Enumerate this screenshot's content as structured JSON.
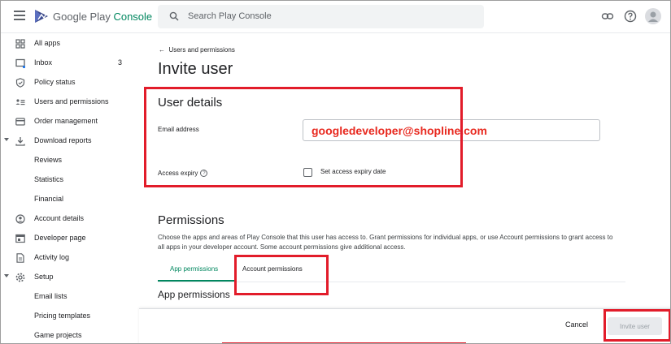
{
  "app": {
    "brand_google": "Google Play",
    "brand_console": "Console",
    "search_placeholder": "Search Play Console"
  },
  "sidebar": {
    "items": [
      {
        "label": "All apps",
        "icon": "grid-icon"
      },
      {
        "label": "Inbox",
        "icon": "inbox-icon",
        "count": "3"
      },
      {
        "label": "Policy status",
        "icon": "shield-icon"
      },
      {
        "label": "Users and permissions",
        "icon": "users-icon"
      },
      {
        "label": "Order management",
        "icon": "card-icon"
      },
      {
        "label": "Download reports",
        "icon": "download-icon"
      },
      {
        "label": "Reviews"
      },
      {
        "label": "Statistics"
      },
      {
        "label": "Financial"
      },
      {
        "label": "Account details",
        "icon": "account-icon"
      },
      {
        "label": "Developer page",
        "icon": "page-icon"
      },
      {
        "label": "Activity log",
        "icon": "log-icon"
      },
      {
        "label": "Setup",
        "icon": "gear-icon"
      },
      {
        "label": "Email lists"
      },
      {
        "label": "Pricing templates"
      },
      {
        "label": "Game projects"
      }
    ]
  },
  "main": {
    "back_link": "Users and permissions",
    "title": "Invite user",
    "user_details": {
      "heading": "User details",
      "email_label": "Email address",
      "email_value": "googledeveloper@shopline.com",
      "expiry_label": "Access expiry",
      "expiry_checkbox_label": "Set access expiry date",
      "expiry_checked": false
    },
    "permissions": {
      "heading": "Permissions",
      "description": "Choose the apps and areas of Play Console that this user has access to. Grant permissions for individual apps, or use Account permissions to grant access to all apps in your developer account. Some account permissions give additional access.",
      "tabs": [
        "App permissions",
        "Account permissions"
      ],
      "active_tab": "App permissions",
      "section_heading": "App permissions"
    }
  },
  "footer": {
    "cancel_label": "Cancel",
    "invite_label": "Invite user"
  },
  "colors": {
    "accent": "#01875f",
    "annotation": "#e21c2a",
    "email_text": "#e8291f"
  }
}
